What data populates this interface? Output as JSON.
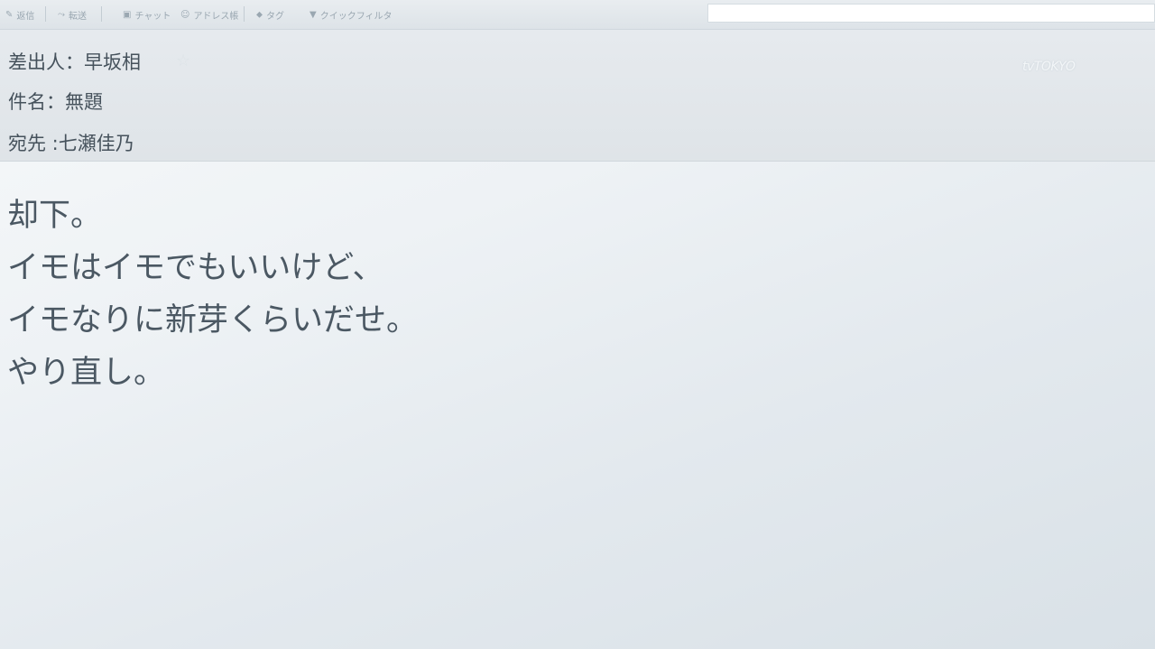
{
  "toolbar": {
    "items": [
      {
        "icon": "✎",
        "label": "返信"
      },
      {
        "icon": "⤳",
        "label": "転送"
      },
      {
        "icon": "▣",
        "label": "チャット"
      },
      {
        "icon": "☺",
        "label": "アドレス帳"
      },
      {
        "icon": "⬥",
        "label": "タグ"
      },
      {
        "icon": "▼",
        "label": "クイックフィルタ"
      }
    ],
    "search_value": ""
  },
  "header": {
    "from_label": "差出人：",
    "from_value": "早坂相",
    "subject_label": "件名：",
    "subject_value": "無題",
    "to_label": "宛先 :",
    "to_value": "七瀬佳乃",
    "star_icon": "☆"
  },
  "logo": "tvTOKYO",
  "body": {
    "lines": [
      "却下。",
      "イモはイモでもいいけど、",
      "イモなりに新芽くらいだせ。",
      "やり直し。"
    ]
  }
}
